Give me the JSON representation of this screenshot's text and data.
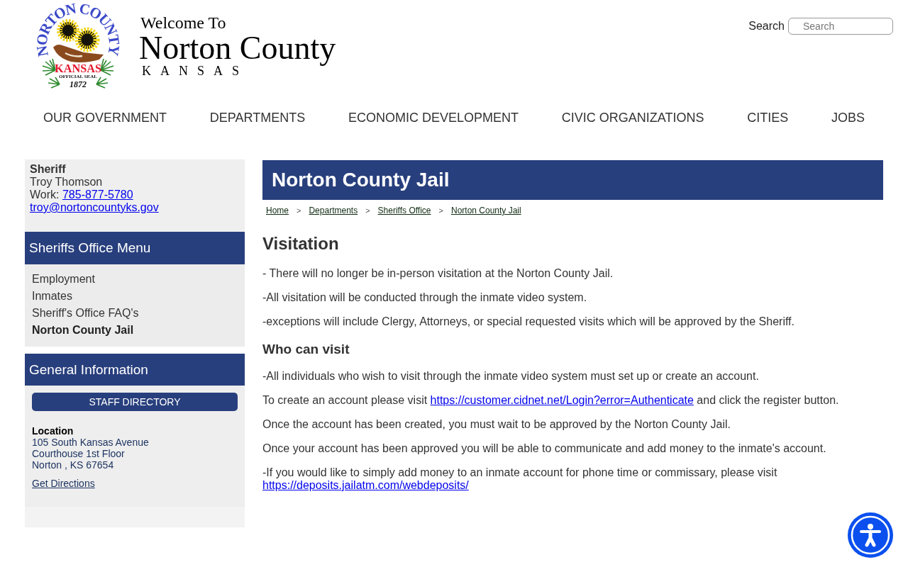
{
  "header": {
    "seal": {
      "arc_text": "NORTON COUNTY",
      "banner": "KANSAS",
      "caption": "OFFICIAL SEAL",
      "year": "1872"
    },
    "welcome": "Welcome To",
    "title": "Norton County",
    "subtitle": "KANSAS",
    "search": {
      "label": "Search",
      "placeholder": "Search"
    }
  },
  "nav": [
    "OUR GOVERNMENT",
    "DEPARTMENTS",
    "ECONOMIC DEVELOPMENT",
    "CIVIC ORGANIZATIONS",
    "CITIES",
    "JOBS"
  ],
  "sidebar": {
    "contact": {
      "role": "Sheriff",
      "name": "Troy Thomson",
      "phone_label": "Work:",
      "phone": "785-877-5780",
      "email": "troy@nortoncountyks.gov"
    },
    "menu": {
      "title": "Sheriffs Office Menu",
      "items": [
        {
          "label": "Employment",
          "selected": false
        },
        {
          "label": "Inmates",
          "selected": false
        },
        {
          "label": "Sheriff's Office FAQ's",
          "selected": false
        },
        {
          "label": "Norton County Jail",
          "selected": true
        }
      ]
    },
    "general": {
      "title": "General Information",
      "button": "STAFF DIRECTORY",
      "location_label": "Location",
      "address": [
        "105 South Kansas Avenue",
        "Courthouse 1st Floor",
        "Norton , KS 67654"
      ],
      "directions": "Get Directions"
    }
  },
  "main": {
    "title": "Norton County Jail",
    "breadcrumb": [
      {
        "kind": "link",
        "label": "Home"
      },
      {
        "kind": "separator",
        "label": ">"
      },
      {
        "kind": "link",
        "label": "Departments"
      },
      {
        "kind": "separator",
        "label": ">"
      },
      {
        "kind": "link",
        "label": "Sheriffs Office"
      },
      {
        "kind": "separator",
        "label": ">"
      },
      {
        "kind": "link",
        "label": "Norton County Jail"
      }
    ],
    "blocks": [
      {
        "kind": "heading",
        "text": "Visitation"
      },
      {
        "kind": "paragraph",
        "parts": [
          {
            "kind": "text",
            "text": "- There will no longer be in-person visitation at the Norton County Jail."
          }
        ]
      },
      {
        "kind": "paragraph",
        "parts": [
          {
            "kind": "text",
            "text": "-All visitation will be conducted through the inmate video system."
          }
        ]
      },
      {
        "kind": "paragraph",
        "parts": [
          {
            "kind": "text",
            "text": "-exceptions will include Clergy, Attorneys, or special requested visits which will be approved by the Sheriff."
          }
        ]
      },
      {
        "kind": "subheading",
        "text": "Who can visit"
      },
      {
        "kind": "paragraph",
        "parts": [
          {
            "kind": "text",
            "text": "-All individuals who wish to visit through the inmate video system must set up or create an account."
          }
        ]
      },
      {
        "kind": "paragraph",
        "parts": [
          {
            "kind": "text",
            "text": "To create an account please visit "
          },
          {
            "kind": "link",
            "text": "https://customer.cidnet.net/Login?error=Authenticate"
          },
          {
            "kind": "text",
            "text": " and click the register button."
          }
        ]
      },
      {
        "kind": "paragraph",
        "parts": [
          {
            "kind": "text",
            "text": "Once the account has been created, you must wait to be approved by the Norton County Jail."
          }
        ]
      },
      {
        "kind": "paragraph",
        "parts": [
          {
            "kind": "text",
            "text": "Once your account has been approved you will be able to communicate and add money to the inmate's account."
          }
        ]
      },
      {
        "kind": "paragraph",
        "parts": [
          {
            "kind": "text",
            "text": "-If you would like to simply add money to an inmate account for phone time or commissary, please visit "
          },
          {
            "kind": "link",
            "text": "https://deposits.jailatm.com/webdeposits/"
          }
        ]
      }
    ]
  }
}
